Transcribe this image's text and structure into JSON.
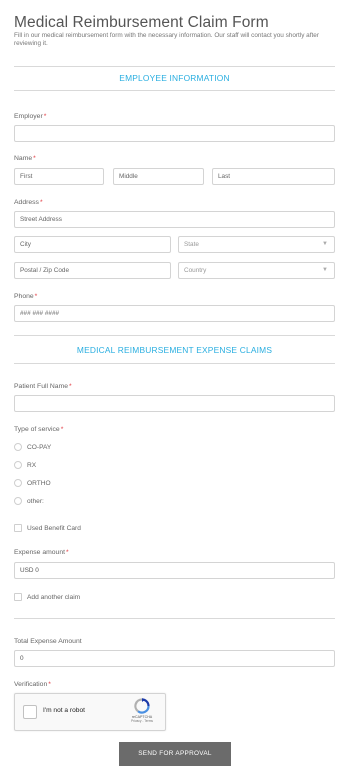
{
  "header": {
    "title": "Medical Reimbursement Claim Form",
    "description": "Fill in our medical reimbursement form with the necessary information. Our staff will contact you shortly after reviewing it."
  },
  "sections": {
    "employee": "EMPLOYEE INFORMATION",
    "expenses": "MEDICAL REIMBURSEMENT EXPENSE CLAIMS"
  },
  "employer": {
    "label": "Employer",
    "value": ""
  },
  "name": {
    "label": "Name",
    "first_placeholder": "First",
    "middle_placeholder": "Middle",
    "last_placeholder": "Last"
  },
  "address": {
    "label": "Address",
    "street_placeholder": "Street Address",
    "city_placeholder": "City",
    "state_placeholder": "State",
    "postal_placeholder": "Postal / Zip Code",
    "country_placeholder": "Country"
  },
  "phone": {
    "label": "Phone",
    "placeholder": "### ### ####"
  },
  "patient": {
    "label": "Patient Full Name",
    "value": ""
  },
  "service": {
    "label": "Type of service",
    "options": [
      "CO-PAY",
      "RX",
      "ORTHO",
      "other:"
    ]
  },
  "benefit_card": {
    "label": "Used Benefit Card"
  },
  "expense": {
    "label": "Expense amount",
    "value": "USD  0"
  },
  "add_claim": {
    "label": "Add another claim"
  },
  "total": {
    "label": "Total Expense Amount",
    "value": "0"
  },
  "verification": {
    "label": "Verification",
    "captcha_text": "I'm not a robot",
    "captcha_brand": "reCAPTCHA",
    "captcha_terms": "Privacy - Terms"
  },
  "required_marker": "*",
  "submit_label": "SEND FOR APPROVAL",
  "colors": {
    "accent": "#29aee0",
    "required": "#e0333a",
    "button": "#6b6b6b"
  }
}
